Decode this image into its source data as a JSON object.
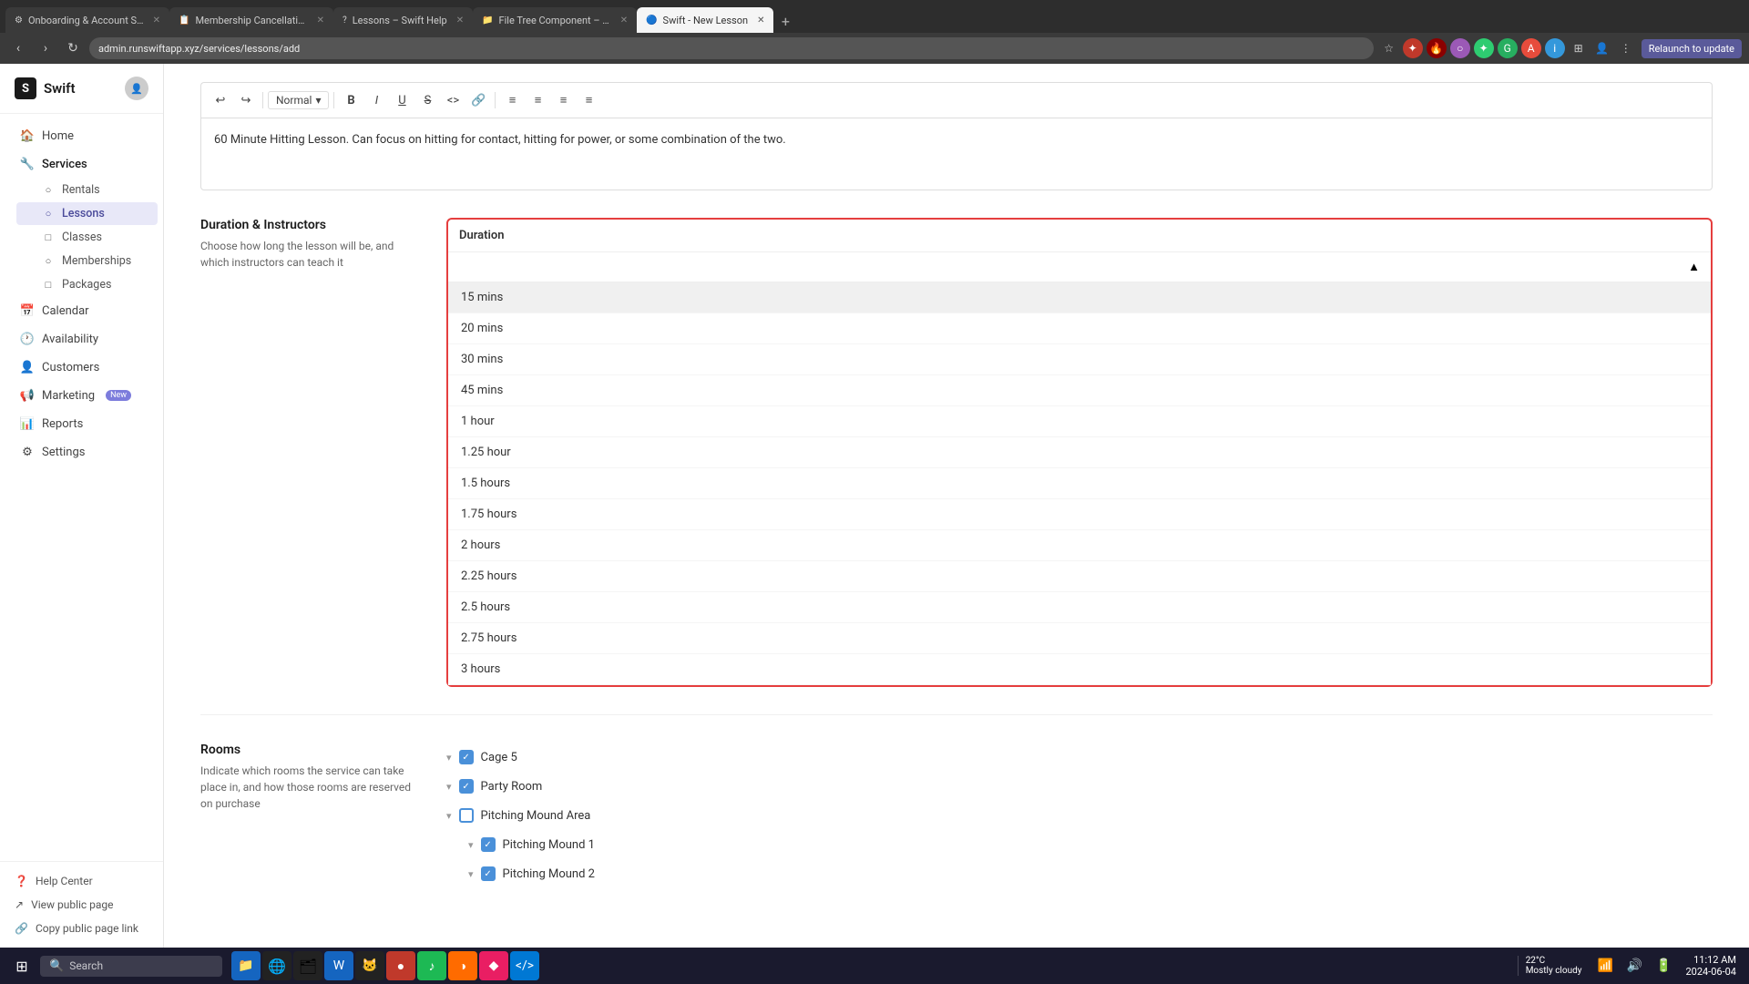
{
  "browser": {
    "tabs": [
      {
        "id": "tab1",
        "title": "Onboarding & Account Setup",
        "active": false
      },
      {
        "id": "tab2",
        "title": "Membership Cancellation Instr...",
        "active": false
      },
      {
        "id": "tab3",
        "title": "Lessons – Swift Help",
        "active": false
      },
      {
        "id": "tab4",
        "title": "File Tree Component – Nextra",
        "active": false
      },
      {
        "id": "tab5",
        "title": "Swift - New Lesson",
        "active": true
      }
    ],
    "address": "admin.runswiftapp.xyz/services/lessons/add",
    "relaunch_label": "Relaunch to update"
  },
  "sidebar": {
    "logo": "Swift",
    "nav_items": [
      {
        "id": "home",
        "label": "Home",
        "icon": "🏠"
      },
      {
        "id": "services",
        "label": "Services",
        "icon": "🔧",
        "active": true,
        "subitems": [
          {
            "id": "rentals",
            "label": "Rentals",
            "icon": "○"
          },
          {
            "id": "lessons",
            "label": "Lessons",
            "icon": "○",
            "active": true
          },
          {
            "id": "classes",
            "label": "Classes",
            "icon": "□"
          },
          {
            "id": "memberships",
            "label": "Memberships",
            "icon": "○"
          },
          {
            "id": "packages",
            "label": "Packages",
            "icon": "□"
          }
        ]
      },
      {
        "id": "calendar",
        "label": "Calendar",
        "icon": "📅"
      },
      {
        "id": "availability",
        "label": "Availability",
        "icon": "🕐"
      },
      {
        "id": "customers",
        "label": "Customers",
        "icon": "👤"
      },
      {
        "id": "marketing",
        "label": "Marketing",
        "icon": "📢",
        "badge": "New"
      },
      {
        "id": "reports",
        "label": "Reports",
        "icon": "📊"
      },
      {
        "id": "settings",
        "label": "Settings",
        "icon": "⚙"
      }
    ],
    "footer": [
      {
        "id": "help",
        "label": "Help Center",
        "icon": "?"
      },
      {
        "id": "view-public",
        "label": "View public page",
        "icon": "↗"
      },
      {
        "id": "copy-link",
        "label": "Copy public page link",
        "icon": "🔗"
      }
    ]
  },
  "editor": {
    "toolbar": {
      "undo": "↩",
      "redo": "↪",
      "style_label": "Normal",
      "bold": "B",
      "italic": "I",
      "underline": "U",
      "strikethrough": "S",
      "code": "<>",
      "link": "🔗"
    },
    "content": "60 Minute Hitting Lesson. Can focus on hitting for contact, hitting for power, or some combination of the two."
  },
  "sections": {
    "duration": {
      "title": "Duration & Instructors",
      "description": "Choose how long the lesson will be, and which instructors can teach it",
      "dropdown_label": "Duration",
      "options": [
        {
          "value": "15mins",
          "label": "15 mins",
          "highlighted": true
        },
        {
          "value": "20mins",
          "label": "20 mins"
        },
        {
          "value": "30mins",
          "label": "30 mins"
        },
        {
          "value": "45mins",
          "label": "45 mins"
        },
        {
          "value": "1hour",
          "label": "1 hour"
        },
        {
          "value": "1.25hour",
          "label": "1.25 hour"
        },
        {
          "value": "1.5hours",
          "label": "1.5 hours"
        },
        {
          "value": "1.75hours",
          "label": "1.75 hours"
        },
        {
          "value": "2hours",
          "label": "2 hours"
        },
        {
          "value": "2.25hours",
          "label": "2.25 hours"
        },
        {
          "value": "2.5hours",
          "label": "2.5 hours"
        },
        {
          "value": "2.75hours",
          "label": "2.75 hours"
        },
        {
          "value": "3hours",
          "label": "3 hours"
        }
      ]
    },
    "rooms": {
      "title": "Rooms",
      "description": "Indicate which rooms the service can take place in, and how those rooms are reserved on purchase",
      "items": [
        {
          "id": "cage5",
          "label": "Cage 5",
          "checked": true,
          "indent": false
        },
        {
          "id": "party-room",
          "label": "Party Room",
          "checked": true,
          "indent": false
        },
        {
          "id": "pitching-mound-area",
          "label": "Pitching Mound Area",
          "checked": false,
          "indent": false
        },
        {
          "id": "pitching-mound-1",
          "label": "Pitching Mound 1",
          "checked": true,
          "indent": true
        },
        {
          "id": "pitching-mound-2",
          "label": "Pitching Mound 2",
          "checked": true,
          "indent": true
        }
      ]
    }
  },
  "taskbar": {
    "search_placeholder": "Search",
    "time": "11:12 AM",
    "date": "2024-06-04",
    "weather": "22°C",
    "weather_desc": "Mostly cloudy"
  }
}
